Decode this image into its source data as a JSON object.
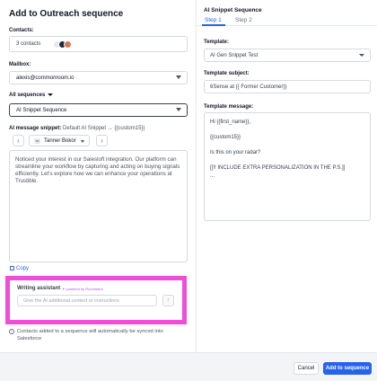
{
  "left_panel": {
    "title": "Add to Outreach sequence",
    "contacts_label": "Contacts:",
    "contacts_value": "3 contacts",
    "mailbox_label": "Mailbox:",
    "mailbox_value": "alexis@commonroom.io",
    "sequences_filter": "All sequences",
    "sequence_value": "AI Snippet Sequence",
    "snippet_label": "AI message snippet:",
    "snippet_value": "Default AI Snippet → {{custom15}}",
    "rep_initials": "TB",
    "rep_name": "Tanner Bokor",
    "message": "Noticed your interest in our Salesloft integration. Our platform can streamline your workflow by capturing and acting on buying signals efficiently. Let's explore how we can enhance your operations at Trustible.",
    "copy_label": "Copy",
    "assistant_title": "Writing assistant",
    "assistant_powered": "✦ powered by Roomiebot",
    "assistant_placeholder": "Give the AI additional context or instructions",
    "info_text": "Contacts added to a sequence will automatically be synced into Salesforce"
  },
  "right_panel": {
    "title": "AI Snippet Sequence",
    "tabs": [
      "Step 1",
      "Step 2"
    ],
    "template_label": "Template:",
    "template_value": "AI Gen Snippet Test",
    "subject_label": "Template subject:",
    "subject_value": "6Sense at {{ Former Customer}}",
    "message_label": "Template message:",
    "message_lines": [
      "Hi {{first_name}},",
      "",
      "{{custom15}}",
      "",
      "Is this on your radar?",
      "",
      "[[!! INCLUDE EXTRA PERSONALIZATION IN THE P.S.]]",
      "..."
    ]
  },
  "footer": {
    "cancel_label": "Cancel",
    "submit_label": "Add to sequence"
  },
  "colors": {
    "accent": "#2563eb",
    "highlight": "#ef4fd8"
  }
}
